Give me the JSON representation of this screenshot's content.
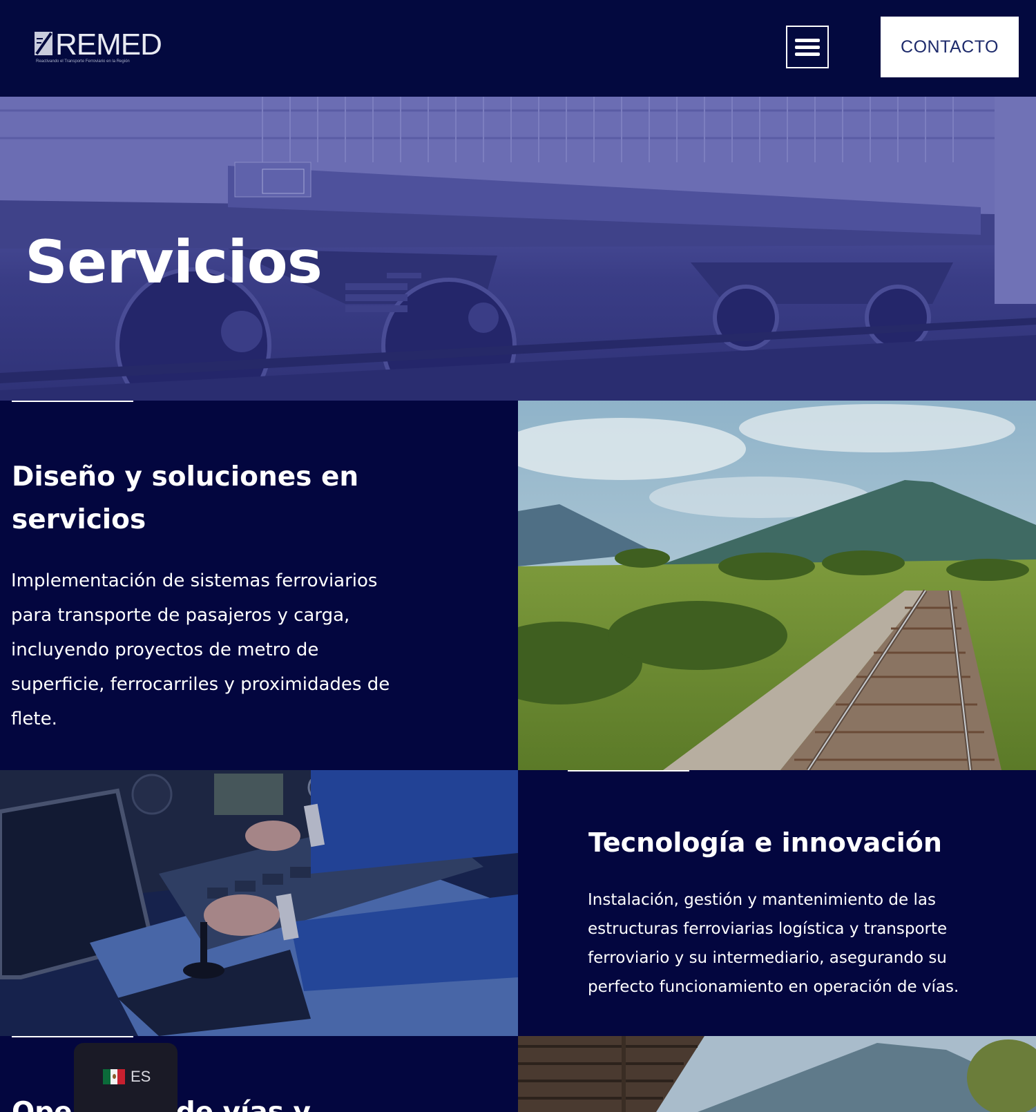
{
  "header": {
    "logo_text": "REMED",
    "logo_tagline": "Reactivando el Transporte Ferroviario en la Región",
    "menu_icon": "hamburger-icon",
    "contact_label": "CONTACTO"
  },
  "hero": {
    "title": "Servicios"
  },
  "sections": [
    {
      "title": "Diseño y soluciones en servicios",
      "body": "Implementación de sistemas ferroviarios para transporte de pasajeros y carga, incluyendo proyectos de metro de superficie, ferrocarriles y proximidades de flete."
    },
    {
      "title": "Tecnología e innovación",
      "body": "Instalación, gestión y mantenimiento de las estructuras ferroviarias logística y transporte ferroviario y su intermediario, asegurando su perfecto funcionamiento en operación de vías."
    },
    {
      "title": "Operación de vías y"
    }
  ],
  "language": {
    "code": "ES",
    "flag_icon": "mexico-flag-icon"
  },
  "colors": {
    "background": "#03063f",
    "header": "#03093f",
    "hero_tint": "#4d509b",
    "contact_text": "#1d2a6b"
  }
}
